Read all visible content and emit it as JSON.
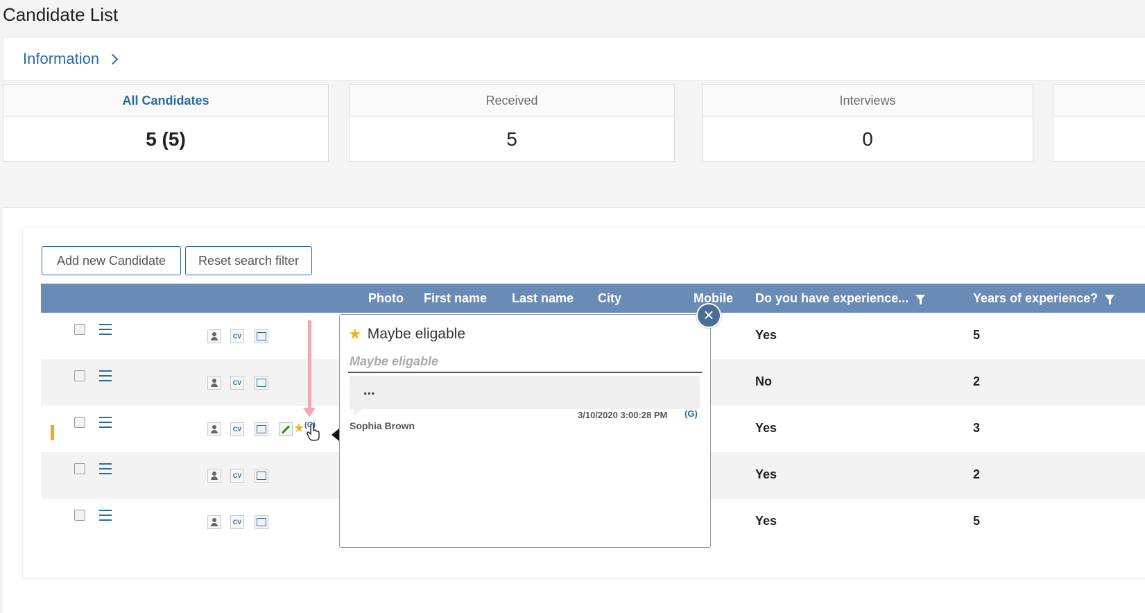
{
  "page": {
    "title": "Candidate List"
  },
  "info": {
    "label": "Information"
  },
  "stats": [
    {
      "label": "All Candidates",
      "value": "5 (5)"
    },
    {
      "label": "Received",
      "value": "5"
    },
    {
      "label": "Interviews",
      "value": "0"
    }
  ],
  "toolbar": {
    "add_label": "Add new Candidate",
    "reset_label": "Reset search filter"
  },
  "grid": {
    "columns": [
      "Photo",
      "First name",
      "Last name",
      "City",
      "Mobile",
      "Do you have experience...",
      "Years of experience?"
    ],
    "rows": [
      {
        "experience": "Yes",
        "years": "5"
      },
      {
        "experience": "No",
        "years": "2"
      },
      {
        "experience": "Yes",
        "years": "3",
        "badge": "(G)"
      },
      {
        "experience": "Yes",
        "years": "2"
      },
      {
        "experience": "Yes",
        "years": "5"
      }
    ],
    "icon_cv": "CV"
  },
  "popup": {
    "title": "Maybe eligable",
    "input_placeholder": "Maybe eligable",
    "comment": "...",
    "author": "Sophia Brown",
    "date": "3/10/2020 3:00:28 PM",
    "badge": "(G)",
    "close_glyph": "×"
  },
  "colors": {
    "accent": "#2b6a9e",
    "header_bg": "#6a8bb5",
    "star": "#f0b429",
    "marker": "#f5a623"
  }
}
